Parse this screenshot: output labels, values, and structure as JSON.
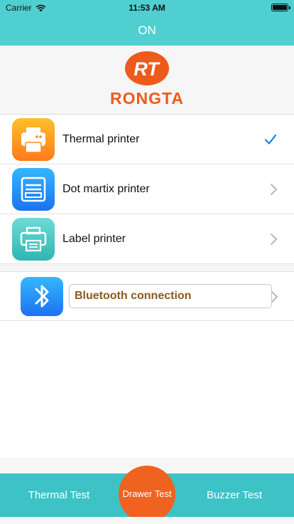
{
  "status_bar": {
    "carrier": "Carrier",
    "time": "11:53 AM",
    "wifi_icon": "wifi-icon",
    "battery_icon": "battery-icon"
  },
  "nav": {
    "title": "ON"
  },
  "brand": {
    "logo_mark": "RT",
    "logo_text": "RONGTA",
    "color": "#ee5a1c"
  },
  "printers": [
    {
      "label": "Thermal printer",
      "icon": "thermal-printer-icon",
      "accessory": "checkmark-icon",
      "selected": true
    },
    {
      "label": "Dot martix printer",
      "icon": "dot-matrix-printer-icon",
      "accessory": "chevron-right-icon",
      "selected": false
    },
    {
      "label": "Label printer",
      "icon": "label-printer-icon",
      "accessory": "chevron-right-icon",
      "selected": false
    }
  ],
  "connection": {
    "icon": "bluetooth-icon",
    "label": "Bluetooth connection",
    "accessory": "chevron-right-icon"
  },
  "tab_bar": {
    "thermal_test": "Thermal Test",
    "drawer_test": "Drawer Test",
    "buzzer_test": "Buzzer Test"
  },
  "colors": {
    "header": "#4fcfd0",
    "tab_bar": "#3dc3c6",
    "accent_orange": "#f0621f",
    "checkmark": "#1a7fe3",
    "bluetooth_text": "#8b5a1d"
  }
}
